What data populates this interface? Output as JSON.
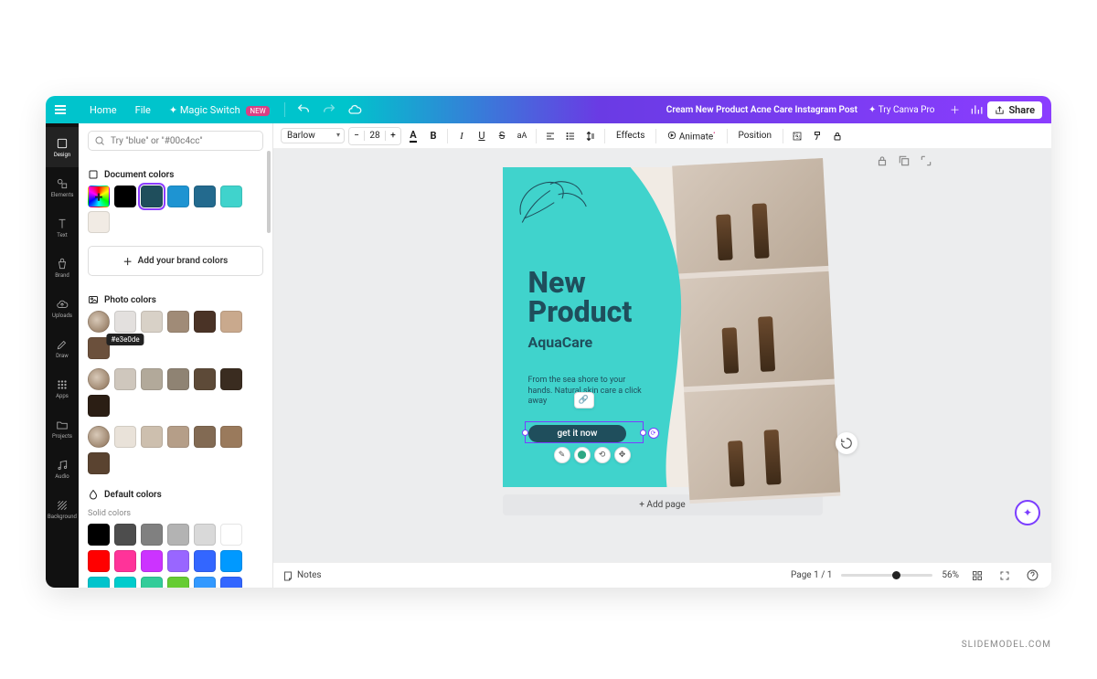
{
  "topbar": {
    "home": "Home",
    "file": "File",
    "magic_switch": "Magic Switch",
    "magic_new": "NEW",
    "document_name": "Cream New Product Acne Care Instagram Post",
    "upgrade": "✦ Try Canva Pro",
    "share": "Share"
  },
  "rail": [
    {
      "id": "design",
      "label": "Design"
    },
    {
      "id": "elements",
      "label": "Elements"
    },
    {
      "id": "text",
      "label": "Text"
    },
    {
      "id": "brand",
      "label": "Brand"
    },
    {
      "id": "uploads",
      "label": "Uploads"
    },
    {
      "id": "draw",
      "label": "Draw"
    },
    {
      "id": "apps",
      "label": "Apps"
    },
    {
      "id": "projects",
      "label": "Projects"
    },
    {
      "id": "audio",
      "label": "Audio"
    },
    {
      "id": "background",
      "label": "Background"
    }
  ],
  "panel": {
    "search_placeholder": "Try \"blue\" or \"#00c4cc\"",
    "document_colors_label": "Document colors",
    "document_colors": [
      "#000000",
      "#1f4e5c",
      "#1e94d2",
      "#236a8e",
      "#40d3cc",
      "#f1ebe4"
    ],
    "selected_index": 1,
    "brand_button": "Add your brand colors",
    "photo_colors_label": "Photo colors",
    "photo_rows": [
      [
        "#e3e0de",
        "#d8d1c7",
        "#a08b77",
        "#4a3326",
        "#c9a98d",
        "#6b503c"
      ],
      [
        "#cfc7bd",
        "#b2a99a",
        "#8f8373",
        "#5d4a38",
        "#3a2c20",
        "#2b1e14"
      ],
      [
        "#e9e2d9",
        "#cdbfae",
        "#b59e88",
        "#826a53",
        "#9a7a5c",
        "#5a4330"
      ]
    ],
    "tooltip_color": "#e3e0de",
    "default_colors_label": "Default colors",
    "solid_label": "Solid colors",
    "default_colors": [
      [
        "#000000",
        "#4d4d4d",
        "#808080",
        "#b3b3b3",
        "#d9d9d9",
        "#ffffff"
      ],
      [
        "#ff0000",
        "#ff3399",
        "#cc33ff",
        "#9966ff",
        "#3366ff",
        "#0099ff"
      ],
      [
        "#00c4cc",
        "#00cccc",
        "#33cc99",
        "#66cc33",
        "#3399ff",
        "#3366ff"
      ],
      [
        "#33cc33",
        "#99e633",
        "#cce633",
        "#ffcc33",
        "#ff9933",
        "#ff6633"
      ]
    ]
  },
  "toolbar": {
    "font": "Barlow",
    "size": "28",
    "effects": "Effects",
    "animate": "Animate",
    "position": "Position"
  },
  "canvas": {
    "title_line1": "New",
    "title_line2": "Product",
    "subtitle": "AquaCare",
    "body": "From the sea shore to your hands. Natural skin care a click away",
    "cta": "get it now",
    "add_page": "+ Add page"
  },
  "footer": {
    "notes": "Notes",
    "page_indicator": "Page 1 / 1",
    "zoom": "56%"
  },
  "watermark": "SLIDEMODEL.COM"
}
